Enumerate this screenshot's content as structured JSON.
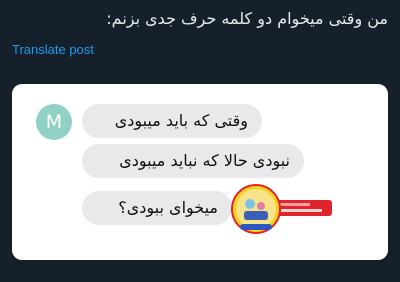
{
  "post": {
    "text": "من وقتی میخوام دو کلمه حرف جدی بزنم:",
    "translate_label": "Translate post"
  },
  "chat": {
    "avatar_letter": "M",
    "messages": [
      "وقتی که باید میبودی",
      "نبودی حالا که نباید میبودی",
      "میخوای ببودی؟"
    ]
  },
  "colors": {
    "background": "#15202b",
    "link": "#1d9bf0",
    "avatar": "#8fd2c4",
    "bubble": "#e9e9eb"
  }
}
